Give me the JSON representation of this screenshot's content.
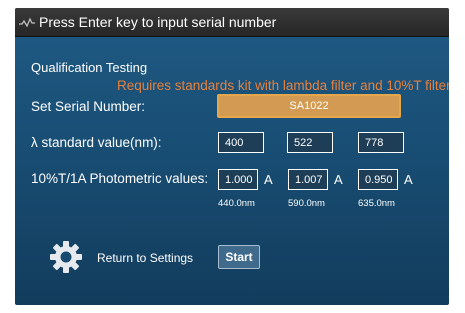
{
  "titlebar": {
    "icon": "signal-wave-icon",
    "title": "Press Enter key to input serial number"
  },
  "section_title": "Qualification Testing",
  "requirement_note": "Requires standards kit with lambda filter and 10%T filter",
  "serial": {
    "label": "Set Serial Number:",
    "value": "SA1022"
  },
  "lambda": {
    "label": "λ standard value(nm):",
    "values": [
      "400",
      "522",
      "778"
    ]
  },
  "photometric": {
    "label": "10%T/1A Photometric values:",
    "unit": "A",
    "values": [
      "1.000",
      "1.007",
      "0.950"
    ],
    "wavelengths": [
      "440.0nm",
      "590.0nm",
      "635.0nm"
    ]
  },
  "footer": {
    "settings_icon": "gear-icon",
    "return_label": "Return to Settings",
    "start_label": "Start"
  },
  "colors": {
    "accent_orange": "#e8803a",
    "serial_field": "#d29a52",
    "background": "#194e75"
  }
}
